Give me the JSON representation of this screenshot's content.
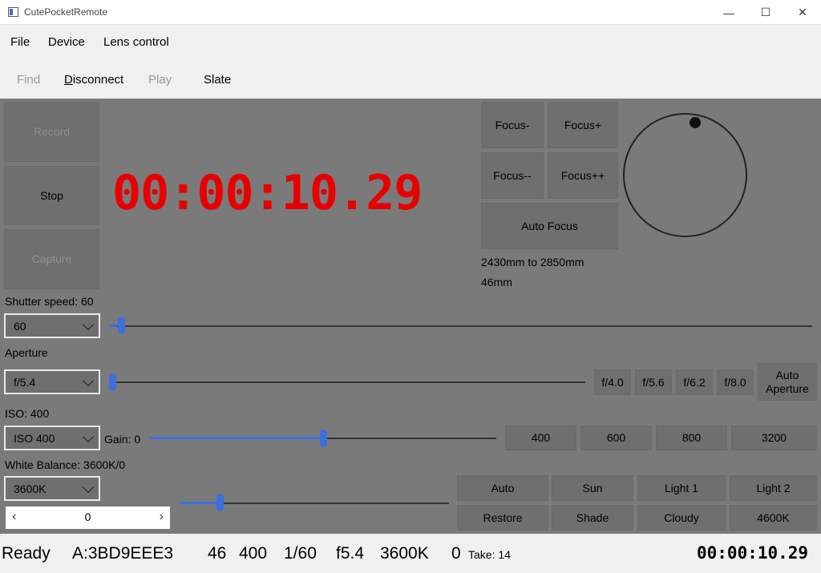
{
  "window": {
    "title": "CutePocketRemote"
  },
  "menubar": {
    "items": [
      "File",
      "Device",
      "Lens control"
    ]
  },
  "toolbar": {
    "find": "Find",
    "disconnect_mnemonic": "D",
    "disconnect_rest": "isconnect",
    "play": "Play",
    "slate": "Slate"
  },
  "transport": {
    "record": "Record",
    "stop": "Stop",
    "capture": "Capture"
  },
  "timecode": "00:00:10.29",
  "focus": {
    "minus": "Focus-",
    "plus": "Focus+",
    "minus_minus": "Focus--",
    "plus_plus": "Focus++",
    "auto": "Auto Focus",
    "range": "2430mm to 2850mm",
    "focal_length": "46mm"
  },
  "shutter": {
    "label": "Shutter speed: 60",
    "value": "60",
    "slider_fraction": 0.01
  },
  "aperture": {
    "label": "Aperture",
    "value": "f/5.4",
    "presets": [
      "f/4.0",
      "f/5.6",
      "f/6.2",
      "f/8.0"
    ],
    "auto_line1": "Auto",
    "auto_line2": "Aperture",
    "slider_fraction": 0.0
  },
  "iso": {
    "label": "ISO: 400",
    "value": "ISO 400",
    "gain_label": "Gain: 0",
    "presets": [
      "400",
      "600",
      "800",
      "3200"
    ],
    "slider_fraction": 0.5
  },
  "white_balance": {
    "label": "White Balance: 3600K/0",
    "value": "3600K",
    "tint": "0",
    "presets_row1": [
      "Auto",
      "Sun",
      "Light 1",
      "Light 2"
    ],
    "presets_row2": [
      "Restore",
      "Shade",
      "Cloudy",
      "4600K"
    ],
    "slider_fraction": 0.15
  },
  "status": {
    "state": "Ready",
    "camera": "A:3BD9EEE3",
    "focal": "46",
    "iso": "400",
    "shutter": "1/60",
    "aperture": "f5.4",
    "wb": "3600K",
    "tint": "0",
    "take": "Take: 14",
    "timecode": "00:00:10.29"
  },
  "colors": {
    "panel_bg": "#7a7a7a",
    "button_bg": "#6f6f6f",
    "timecode_red": "#e80000",
    "slider_blue": "#3b6fe0"
  }
}
